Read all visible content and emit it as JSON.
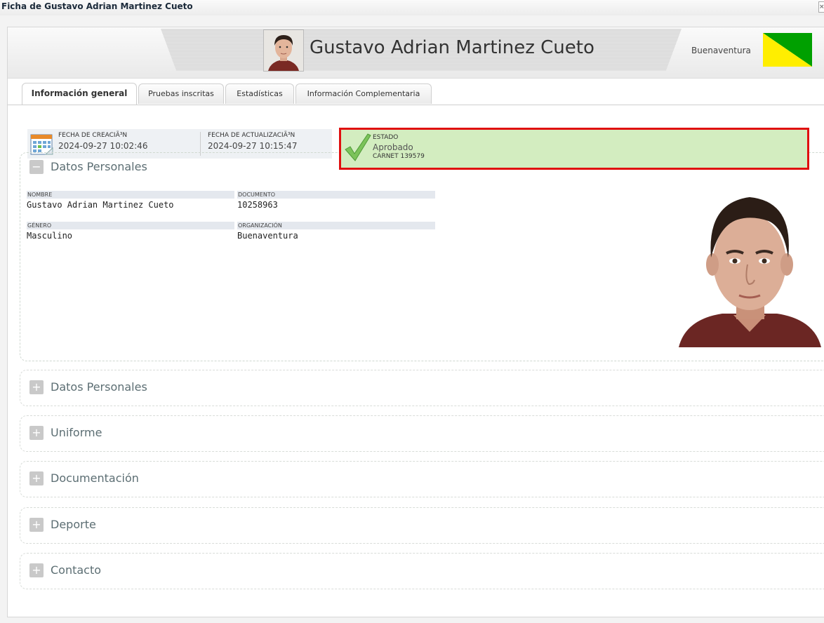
{
  "window": {
    "title": "Ficha de Gustavo Adrian Martinez Cueto",
    "close_label": "×"
  },
  "header": {
    "name": "Gustavo Adrian Martinez Cueto",
    "organization": "Buenaventura",
    "flag_colors": [
      "#ffee00",
      "#00a000"
    ]
  },
  "tabs": [
    {
      "label": "Información general",
      "active": true
    },
    {
      "label": "Pruebas inscritas",
      "active": false
    },
    {
      "label": "Estadísticas",
      "active": false
    },
    {
      "label": "Información Complementaria",
      "active": false
    }
  ],
  "meta": {
    "created_label": "FECHA DE CREACIÃ³N",
    "created_value": "2024-09-27 10:02:46",
    "updated_label": "FECHA DE ACTUALIZACIÃ³N",
    "updated_value": "2024-09-27 10:15:47"
  },
  "status": {
    "label": "ESTADO",
    "value": "Aprobado",
    "carnet": "CARNET 139579",
    "background": "#d3edc0",
    "highlight_border": "#e01010"
  },
  "datos_personales": {
    "title": "Datos Personales",
    "toggle": "−",
    "fields": {
      "nombre_label": "NOMBRE",
      "nombre_value": "Gustavo Adrian Martinez Cueto",
      "documento_label": "DOCUMENTO",
      "documento_value": "10258963",
      "genero_label": "GÉNERO",
      "genero_value": "Masculino",
      "organizacion_label": "ORGANIZACIÓN",
      "organizacion_value": "Buenaventura"
    }
  },
  "collapsed_sections": [
    {
      "title": "Datos Personales",
      "toggle": "+"
    },
    {
      "title": "Uniforme",
      "toggle": "+"
    },
    {
      "title": "Documentación",
      "toggle": "+"
    },
    {
      "title": "Deporte",
      "toggle": "+"
    },
    {
      "title": "Contacto",
      "toggle": "+"
    }
  ]
}
